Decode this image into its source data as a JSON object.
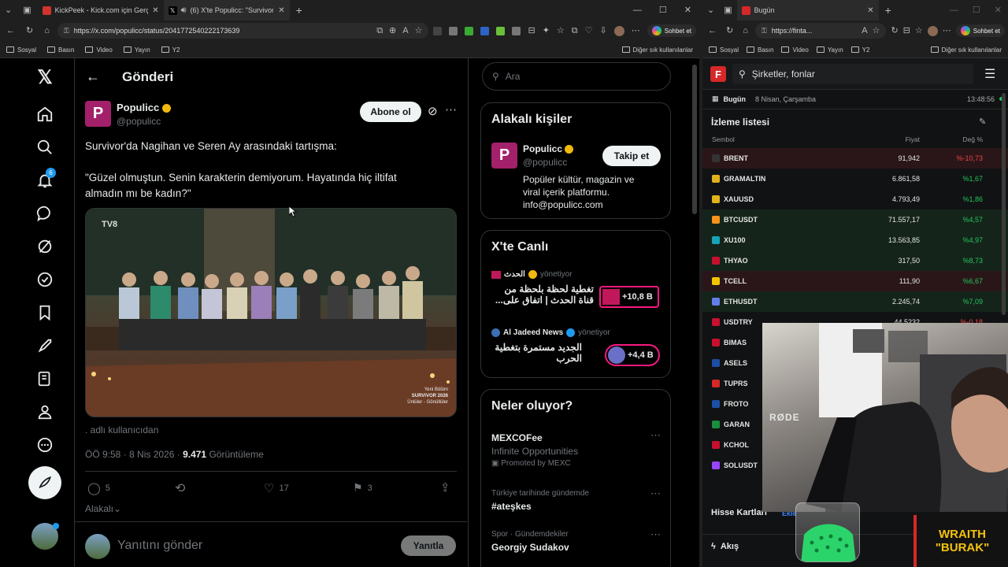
{
  "left_browser": {
    "tabs": [
      {
        "label": "KickPeek - Kick.com için Gerçek Za",
        "favicon_color": "#d0342c"
      },
      {
        "label": "(6) X'te Populicc: \"Survivor'da",
        "favicon_color": "#000000"
      }
    ],
    "url": "https://x.com/populicc/status/2041772540222173639",
    "chat_label": "Sohbet et",
    "bookmarks": [
      "Sosyal",
      "Basın",
      "Video",
      "Yayın",
      "Y2"
    ],
    "other_bookmarks": "Diğer sık kullanılanlar"
  },
  "x": {
    "notif_count": "6",
    "header_title": "Gönderi",
    "author_name": "Populicc",
    "author_handle": "@populicc",
    "subscribe_label": "Abone ol",
    "tweet_line1": "Survivor'da Nagihan ve Seren Ay arasındaki tartışma:",
    "tweet_line2": "\"Güzel olmuştun. Senin karakterin demiyorum. Hayatında hiç iltifat",
    "tweet_line3": "almadın mı be kadın?\"",
    "video_badge": "Yeni Bölüm",
    "video_title": "SURVIVOR 2026",
    "video_sub": "Ünlüler - Gönüllüler",
    "channel_logo": "TV8",
    "source_note": ". adlı kullanıcıdan",
    "time": "ÖÖ 9:58",
    "date": "8 Nis 2026",
    "views": "9.471",
    "views_label": "Görüntüleme",
    "replies": "5",
    "likes": "17",
    "bookmarks": "3",
    "relevant_label": "Alakalı",
    "reply_placeholder": "Yanıtını gönder",
    "reply_button": "Yanıtla",
    "search_placeholder": "Ara",
    "related_title": "Alakalı kişiler",
    "related_name": "Populicc",
    "related_handle": "@populicc",
    "follow_label": "Takip et",
    "related_bio1": "Popüler kültür, magazin ve",
    "related_bio2": "viral içerik platformu.",
    "related_bio3": "info@populicc.com",
    "live_title": "X'te Canlı",
    "live": [
      {
        "host": "الحدث",
        "status": "yönetiyor",
        "title1": "تغطية لحظة بلحظة من",
        "title2": "قناة الحدث | اتفاق على...",
        "count": "+10,8 B"
      },
      {
        "host": "Al Jadeed News",
        "status": "yönetiyor",
        "title1": "الجديد مستمرة بتغطية",
        "title2": "الحرب",
        "count": "+4,4 B"
      }
    ],
    "trends_title": "Neler oluyor?",
    "trends": [
      {
        "meta": "MEXCOFee",
        "sub": "Infinite Opportunities",
        "promo": "Promoted by MEXC"
      },
      {
        "meta": "Türkiye tarihinde gündemde",
        "name": "#ateşkes"
      },
      {
        "meta": "Spor · Gündemdekiler",
        "name": "Georgiy Sudakov"
      }
    ]
  },
  "right_browser": {
    "tab_label": "Bugün",
    "url": "https://finta...",
    "chat_label": "Sohbet et",
    "bookmarks": [
      "Sosyal",
      "Basın",
      "Video",
      "Yayın",
      "Y2"
    ],
    "other_bookmarks": "Diğer sık kullanılanlar",
    "search_placeholder": "Şirketler, fonlar",
    "today_label": "Bugün",
    "date": "8 Nisan, Çarşamba",
    "clock": "13:48:56",
    "watchlist_title": "İzleme listesi",
    "col_symbol": "Sembol",
    "col_price": "Fiyat",
    "col_change": "Değ %",
    "rows": [
      {
        "sym": "BRENT",
        "price": "91,942",
        "change": "%-10,73",
        "dir": "neg",
        "color": "#333333"
      },
      {
        "sym": "GRAMALTIN",
        "price": "6.861,58",
        "change": "%1,67",
        "dir": "pos",
        "color": "#e0b21b"
      },
      {
        "sym": "XAUUSD",
        "price": "4.793,49",
        "change": "%1,86",
        "dir": "pos",
        "color": "#e0b21b"
      },
      {
        "sym": "BTCUSDT",
        "price": "71.557,17",
        "change": "%4,57",
        "dir": "pos",
        "color": "#f7931a"
      },
      {
        "sym": "XU100",
        "price": "13.563,85",
        "change": "%4,97",
        "dir": "pos",
        "color": "#15a4b5"
      },
      {
        "sym": "THYAO",
        "price": "317,50",
        "change": "%8,73",
        "dir": "pos",
        "color": "#c8102e"
      },
      {
        "sym": "TCELL",
        "price": "111,90",
        "change": "%6,67",
        "dir": "pos",
        "color": "#f4c300"
      },
      {
        "sym": "ETHUSDT",
        "price": "2.245,74",
        "change": "%7,09",
        "dir": "pos",
        "color": "#627eea"
      },
      {
        "sym": "USDTRY",
        "price": "44,5232",
        "change": "%-0,18",
        "dir": "neg",
        "color": "#c8102e"
      },
      {
        "sym": "BIMAS",
        "price": "",
        "change": "",
        "dir": "pos",
        "color": "#c8102e"
      },
      {
        "sym": "ASELS",
        "price": "",
        "change": "",
        "dir": "pos",
        "color": "#1c4fa3"
      },
      {
        "sym": "TUPRS",
        "price": "",
        "change": "",
        "dir": "pos",
        "color": "#d62828"
      },
      {
        "sym": "FROTO",
        "price": "",
        "change": "",
        "dir": "pos",
        "color": "#1c4fa3"
      },
      {
        "sym": "GARAN",
        "price": "",
        "change": "",
        "dir": "pos",
        "color": "#1a8f3e"
      },
      {
        "sym": "KCHOL",
        "price": "",
        "change": "",
        "dir": "pos",
        "color": "#c8102e"
      },
      {
        "sym": "SOLUSDT",
        "price": "",
        "change": "",
        "dir": "pos",
        "color": "#9945ff"
      }
    ],
    "cards_title": "Hisse Kartları",
    "cards_add": "Ekle",
    "flow_label": "Akış",
    "overlay_line1": "WRAITH",
    "overlay_line2": "\"BURAK\"",
    "mic_brand": "RØDE"
  }
}
